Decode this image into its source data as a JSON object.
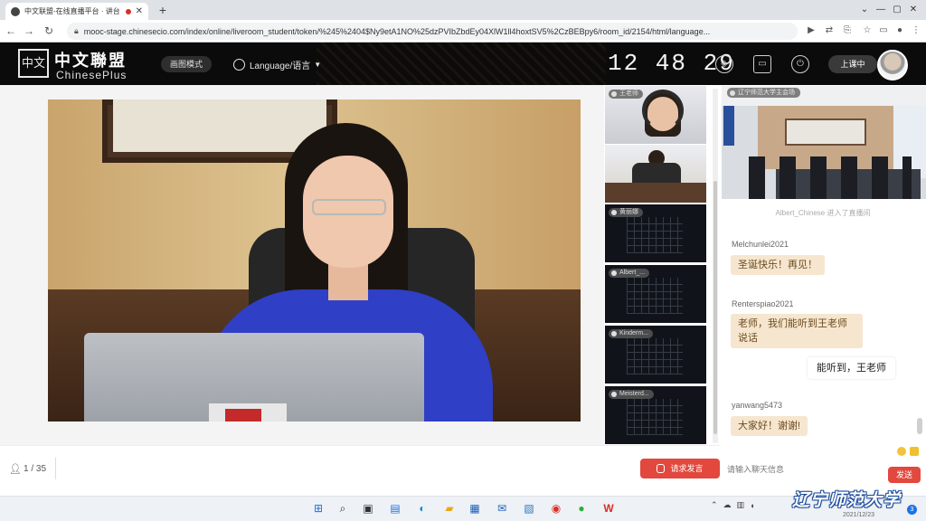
{
  "browser": {
    "tab_title": "中文联盟-在线直播平台 · 讲台",
    "url": "mooc-stage.chinesecio.com/index/online/liveroom_student/token/%245%2404$Ny9etA1NO%25dzPVIbZbdEy04XlW1ll4hoxtSV5%2CzBEBpy6/room_id/2154/html/language..."
  },
  "header": {
    "logo_cn": "中文聯盟",
    "logo_en": "ChinesePlus",
    "mode_label": "画图模式",
    "language_label": "Language/语言",
    "clock": "12 48 29",
    "class_status": "上课中"
  },
  "tiles": [
    {
      "label": "王老师"
    },
    {
      "label": ""
    },
    {
      "label": "黄丽娜"
    },
    {
      "label": "Albert_..."
    },
    {
      "label": "Kinderm..."
    },
    {
      "label": "Meisterd..."
    }
  ],
  "room_video": {
    "label": "辽宁师范大学主会场"
  },
  "chat": {
    "system_message": "Albert_Chinese 进入了直播间",
    "messages": [
      {
        "user": "Melchunlei2021",
        "text": "圣诞快乐！再见！"
      },
      {
        "user": "Renterspiao2021",
        "text": "老师，我们能听到王老师说话"
      },
      {
        "user": "",
        "text": "能听到，王老师"
      },
      {
        "user": "yanwang5473",
        "text": "大家好！谢谢!"
      }
    ],
    "input_placeholder": "请输入聊天信息",
    "send_label": "发送"
  },
  "bottom": {
    "user_count": "1 / 35",
    "talk_button": "请求发言"
  },
  "taskbar": {
    "date": "2021/12/23",
    "notifications": "3"
  },
  "watermark": "辽宁师范大学"
}
